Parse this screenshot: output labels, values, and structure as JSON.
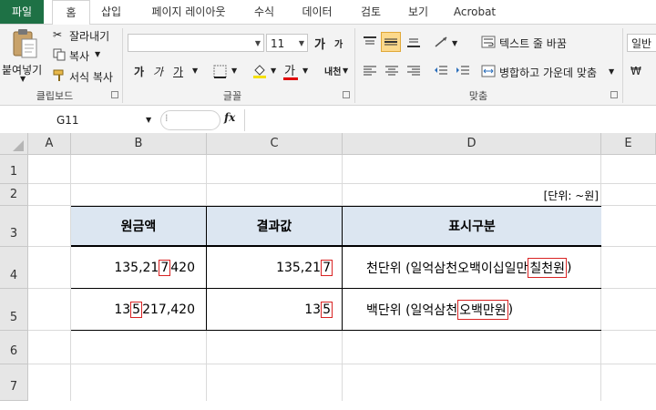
{
  "ribbon_tabs": [
    "파일",
    "홈",
    "삽입",
    "페이지 레이아웃",
    "수식",
    "데이터",
    "검토",
    "보기",
    "Acrobat"
  ],
  "clipboard": {
    "paste": "붙여넣기",
    "cut": "잘라내기",
    "copy": "복사",
    "format_painter": "서식 복사",
    "group": "클립보드"
  },
  "font": {
    "family": "",
    "size": "11",
    "grow": "가",
    "shrink": "가",
    "bold": "가",
    "italic": "가",
    "underline": "가",
    "font_color": "가",
    "phonetic": "내천",
    "group": "글꼴"
  },
  "alignment": {
    "wrap_text": "텍스트 줄 바꿈",
    "merge_center": "병합하고 가운데 맞춤",
    "group": "맞춤"
  },
  "number": {
    "format": "일반"
  },
  "formula_bar": {
    "name_box": "G11",
    "fx": "fx",
    "formula": ""
  },
  "columns": [
    "A",
    "B",
    "C",
    "D",
    "E"
  ],
  "rows": [
    "1",
    "2",
    "3",
    "4",
    "5",
    "6",
    "7"
  ],
  "sheet": {
    "unit_note": "[단위: ~원]",
    "headers": [
      "원금액",
      "결과값",
      "표시구분"
    ],
    "row4": {
      "amount_pre": "135,21",
      "amount_box": "7",
      "amount_post": "420",
      "result_pre": "135,21",
      "result_box": "7",
      "desc_pre": "천단위 (일억삼천오백이십일만",
      "desc_box": "칠천원",
      "desc_post": ")"
    },
    "row5": {
      "amount_pre": "13",
      "amount_box": "5",
      "amount_post": "217,420",
      "result_pre": "13",
      "result_box": "5",
      "desc_pre": "백단위 (일억삼천",
      "desc_box": "오백만원",
      "desc_post": ")"
    }
  },
  "colors": {
    "file_tab": "#1e7145",
    "header_fill": "#dce6f1",
    "highlight_border": "#d92323"
  }
}
